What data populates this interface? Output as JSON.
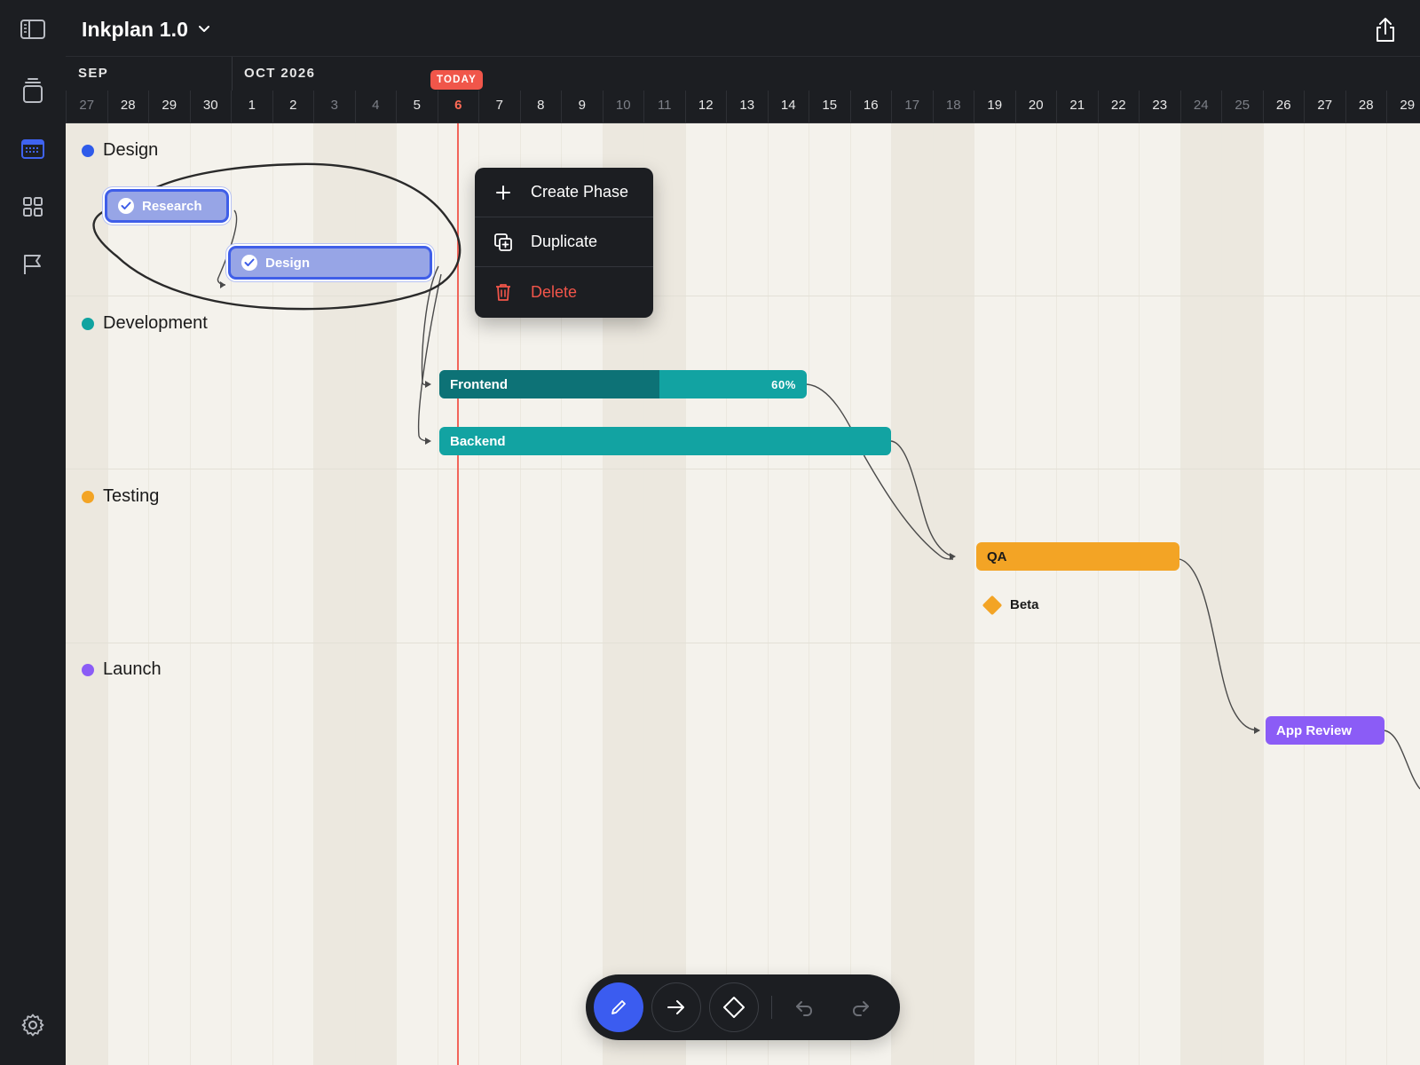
{
  "app": {
    "project_title": "Inkplan 1.0"
  },
  "rail": {
    "items": [
      {
        "icon": "sidebar-toggle-icon"
      },
      {
        "icon": "stack-icon"
      },
      {
        "icon": "calendar-icon",
        "active": true
      },
      {
        "icon": "grid-icon"
      },
      {
        "icon": "flag-icon"
      },
      {
        "icon": "settings-gear-icon"
      }
    ]
  },
  "timeline": {
    "months": [
      {
        "label": "SEP"
      },
      {
        "label": "OCT 2026"
      }
    ],
    "today_badge": "TODAY",
    "days": [
      {
        "label": "27",
        "weekend": true
      },
      {
        "label": "28",
        "weekend": false
      },
      {
        "label": "29",
        "weekend": false
      },
      {
        "label": "30",
        "weekend": false
      },
      {
        "label": "1",
        "weekend": false
      },
      {
        "label": "2",
        "weekend": false
      },
      {
        "label": "3",
        "weekend": true
      },
      {
        "label": "4",
        "weekend": true
      },
      {
        "label": "5",
        "weekend": false
      },
      {
        "label": "6",
        "weekend": false,
        "today": true
      },
      {
        "label": "7",
        "weekend": false
      },
      {
        "label": "8",
        "weekend": false
      },
      {
        "label": "9",
        "weekend": false
      },
      {
        "label": "10",
        "weekend": true
      },
      {
        "label": "11",
        "weekend": true
      },
      {
        "label": "12",
        "weekend": false
      },
      {
        "label": "13",
        "weekend": false
      },
      {
        "label": "14",
        "weekend": false
      },
      {
        "label": "15",
        "weekend": false
      },
      {
        "label": "16",
        "weekend": false
      },
      {
        "label": "17",
        "weekend": true
      },
      {
        "label": "18",
        "weekend": true
      },
      {
        "label": "19",
        "weekend": false
      },
      {
        "label": "20",
        "weekend": false
      },
      {
        "label": "21",
        "weekend": false
      },
      {
        "label": "22",
        "weekend": false
      },
      {
        "label": "23",
        "weekend": false
      },
      {
        "label": "24",
        "weekend": true
      },
      {
        "label": "25",
        "weekend": true
      },
      {
        "label": "26",
        "weekend": false
      },
      {
        "label": "27",
        "weekend": false
      },
      {
        "label": "28",
        "weekend": false
      },
      {
        "label": "29",
        "weekend": false
      }
    ]
  },
  "groups": [
    {
      "label": "Design",
      "color": "#2f5bea"
    },
    {
      "label": "Development",
      "color": "#10a3a0"
    },
    {
      "label": "Testing",
      "color": "#f3a425"
    },
    {
      "label": "Launch",
      "color": "#8b5cf6"
    }
  ],
  "tasks": [
    {
      "id": "research",
      "label": "Research",
      "completed": true,
      "selected": true,
      "color": "#97a5e6"
    },
    {
      "id": "design",
      "label": "Design",
      "completed": true,
      "selected": true,
      "color": "#97a5e6"
    },
    {
      "id": "frontend",
      "label": "Frontend",
      "progress": 0.6,
      "progress_label": "60%",
      "color": "#12a3a2",
      "fill_color": "#0d7276"
    },
    {
      "id": "backend",
      "label": "Backend",
      "color": "#12a3a2"
    },
    {
      "id": "qa",
      "label": "QA",
      "color": "#f3a425"
    },
    {
      "id": "app-review",
      "label": "App Review",
      "color": "#8b5cf6"
    }
  ],
  "milestones": [
    {
      "label": "Beta",
      "color": "#f3a425"
    }
  ],
  "context_menu": {
    "items": [
      {
        "label": "Create Phase",
        "icon": "plus-icon"
      },
      {
        "label": "Duplicate",
        "icon": "duplicate-icon"
      },
      {
        "label": "Delete",
        "icon": "trash-icon",
        "danger": true
      }
    ]
  },
  "toolbar": {
    "tools": [
      {
        "icon": "pencil-icon",
        "active": true
      },
      {
        "icon": "arrow-right-icon"
      },
      {
        "icon": "diamond-icon"
      },
      {
        "icon": "undo-icon"
      },
      {
        "icon": "redo-icon"
      }
    ]
  }
}
